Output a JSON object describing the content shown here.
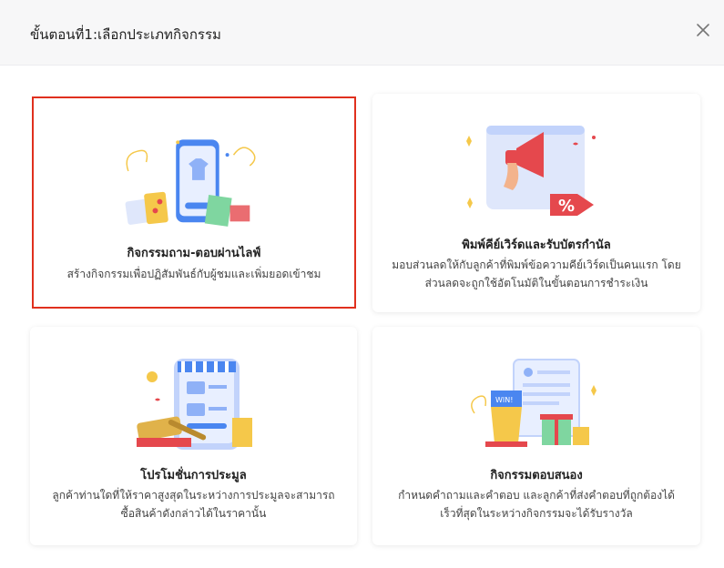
{
  "dialog": {
    "title": "ขั้นตอนที่1:เลือกประเภทกิจกรรม",
    "close_icon": "close-icon"
  },
  "cards": [
    {
      "title": "กิจกรรมถาม-ตอบผ่านไลฟ์",
      "description": "สร้างกิจกรรมเพื่อปฏิสัมพันธ์กับผู้ชมและเพิ่มยอดเข้าชม",
      "icon": "live-qa-illustration",
      "selected": true
    },
    {
      "title": "พิมพ์คีย์เวิร์ดและรับบัตรกำนัล",
      "description": "มอบส่วนลดให้กับลูกค้าที่พิมพ์ข้อความคีย์เวิร์ดเป็นคนแรก โดยส่วนลดจะถูกใช้อัตโนมัติในขั้นตอนการชำระเงิน",
      "icon": "keyword-voucher-illustration",
      "selected": false
    },
    {
      "title": "โปรโมชั่นการประมูล",
      "description": "ลูกค้าท่านใดที่ให้ราคาสูงสุดในระหว่างการประมูลจะสามารถซื้อสินค้าดังกล่าวได้ในราคานั้น",
      "icon": "auction-illustration",
      "selected": false
    },
    {
      "title": "กิจกรรมตอบสนอง",
      "description": "กำหนดคำถามและคำตอบ และลูกค้าที่ส่งคำตอบที่ถูกต้องได้เร็วที่สุดในระหว่างกิจกรรมจะได้รับรางวัล",
      "icon": "quiz-prize-illustration",
      "selected": false
    }
  ],
  "colors": {
    "selected_border": "#e0301e",
    "primary_blue": "#4a86f0",
    "accent_red": "#e5484d",
    "accent_yellow": "#f5b83d"
  }
}
